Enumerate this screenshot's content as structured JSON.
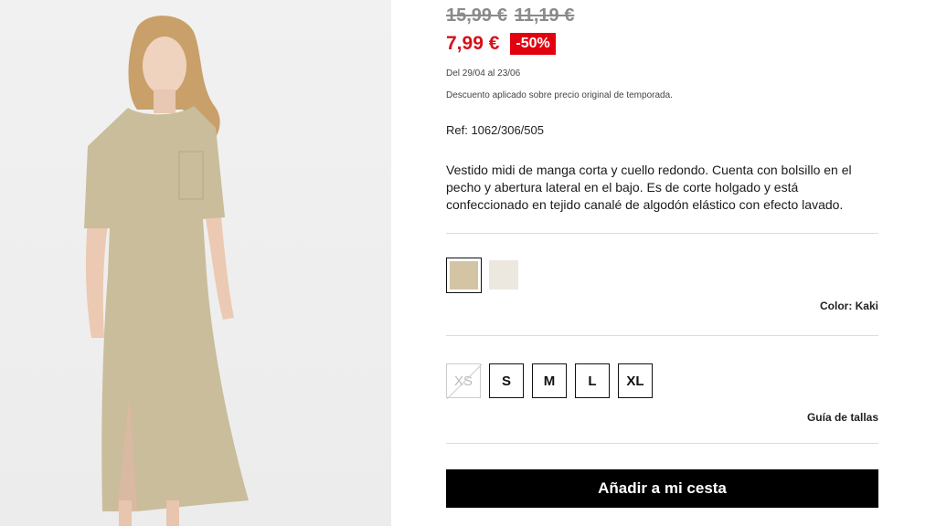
{
  "product": {
    "image_alt": "Model wearing khaki midi t-shirt dress",
    "old_prices": [
      "15,99 €",
      "11,19 €"
    ],
    "current_price": "7,99 €",
    "discount_badge": "-50%",
    "dates": "Del 29/04 al 23/06",
    "discount_note": "Descuento aplicado sobre precio original de temporada.",
    "reference": "Ref: 1062/306/505",
    "description": "Vestido midi de manga corta y cuello redondo. Cuenta con bolsillo en el pecho y abertura lateral en el bajo. Es de corte holgado y está confeccionado en tejido canalé de algodón elástico con efecto lavado."
  },
  "colors": {
    "swatches": [
      {
        "name": "Kaki",
        "hex": "#d3c4a4",
        "selected": true
      },
      {
        "name": "Crudo",
        "hex": "#ede8df",
        "selected": false
      }
    ],
    "label": "Color: Kaki"
  },
  "sizes": {
    "options": [
      {
        "label": "XS",
        "available": false
      },
      {
        "label": "S",
        "available": true
      },
      {
        "label": "M",
        "available": true
      },
      {
        "label": "L",
        "available": true
      },
      {
        "label": "XL",
        "available": true
      }
    ],
    "guide_label": "Guía de tallas"
  },
  "actions": {
    "add_to_cart": "Añadir a mi cesta"
  },
  "theme": {
    "sale_red": "#d51118",
    "badge_red": "#e3000f",
    "dress_color": "#c9bd9b"
  }
}
